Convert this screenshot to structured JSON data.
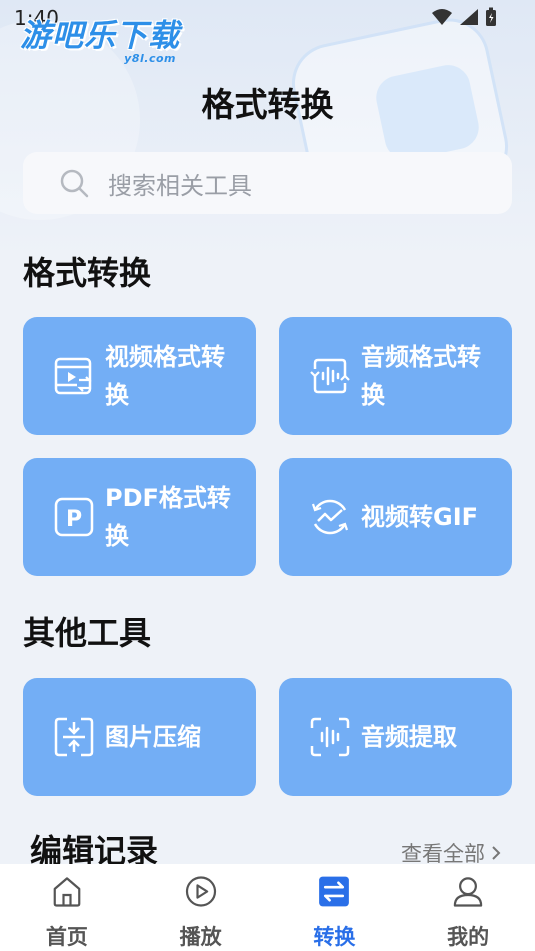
{
  "status_bar": {
    "time": "1:40"
  },
  "logo": {
    "main": "游吧乐下载",
    "sub": "y8l.com"
  },
  "header": {
    "title": "格式转换"
  },
  "search": {
    "placeholder": "搜索相关工具"
  },
  "sections": {
    "format": {
      "title": "格式转换",
      "cards": [
        {
          "label_line1": "视频格式转",
          "label_line2": "换",
          "icon": "video-convert-icon"
        },
        {
          "label_line1": "音频格式转",
          "label_line2": "换",
          "icon": "audio-convert-icon"
        },
        {
          "label_line1": "PDF格式转",
          "label_line2": "换",
          "icon": "pdf-icon"
        },
        {
          "label_line1": "视频转GIF",
          "label_line2": "",
          "icon": "gif-icon"
        }
      ]
    },
    "other": {
      "title": "其他工具",
      "cards": [
        {
          "label_line1": "图片压缩",
          "icon": "image-compress-icon"
        },
        {
          "label_line1": "音频提取",
          "icon": "audio-extract-icon"
        }
      ]
    },
    "records": {
      "title": "编辑记录",
      "see_all": "查看全部"
    }
  },
  "tab_bar": {
    "tabs": [
      {
        "label": "首页",
        "icon": "home-icon",
        "active": false
      },
      {
        "label": "播放",
        "icon": "play-icon",
        "active": false
      },
      {
        "label": "转换",
        "icon": "convert-icon",
        "active": true
      },
      {
        "label": "我的",
        "icon": "user-icon",
        "active": false
      }
    ]
  },
  "colors": {
    "accent": "#2a6fe8",
    "card": "#73aef5",
    "background": "#eef2f8"
  }
}
